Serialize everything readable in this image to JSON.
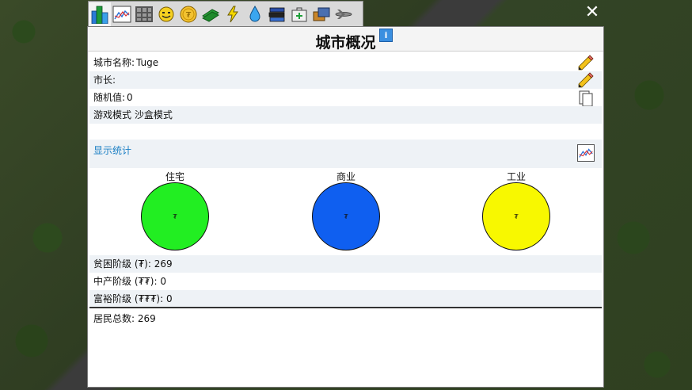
{
  "window": {
    "title": "城市概况",
    "info_label": "i",
    "close_label": "✕"
  },
  "tabs": [
    {
      "name": "city-info-tab",
      "icon": "buildings-icon",
      "active": true
    },
    {
      "name": "graphs-tab",
      "icon": "line-chart-icon"
    },
    {
      "name": "zones-tab",
      "icon": "grid-icon"
    },
    {
      "name": "happiness-tab",
      "icon": "smiley-icon"
    },
    {
      "name": "budget-tab",
      "icon": "coin-icon"
    },
    {
      "name": "money-tab",
      "icon": "banknote-icon"
    },
    {
      "name": "power-tab",
      "icon": "lightning-icon"
    },
    {
      "name": "water-tab",
      "icon": "water-drop-icon"
    },
    {
      "name": "education-tab",
      "icon": "books-icon"
    },
    {
      "name": "health-tab",
      "icon": "medical-kit-icon"
    },
    {
      "name": "mail-tab",
      "icon": "mail-icon"
    },
    {
      "name": "transport-tab",
      "icon": "airplane-icon"
    }
  ],
  "info": {
    "city_name_label": "城市名称:",
    "city_name_value": "Tuge",
    "mayor_label": "市长:",
    "mayor_value": "",
    "seed_label": "随机值:",
    "seed_value": "0",
    "game_mode_label": "游戏模式",
    "game_mode_value": "沙盒模式"
  },
  "stats": {
    "show_stats_label": "显示统计"
  },
  "zones": [
    {
      "label": "住宅",
      "symbol": "₮",
      "color": "#22ee22"
    },
    {
      "label": "商业",
      "symbol": "₮",
      "color": "#0f5ff0"
    },
    {
      "label": "工业",
      "symbol": "₮",
      "color": "#f8f800"
    }
  ],
  "wealth": {
    "poor_label": "贫困阶级 (₮):",
    "poor_value": "269",
    "middle_label": "中产阶级 (₮₮):",
    "middle_value": "0",
    "rich_label": "富裕阶级 (₮₮₮):",
    "rich_value": "0"
  },
  "population": {
    "label": "居民总数:",
    "value": "269"
  }
}
